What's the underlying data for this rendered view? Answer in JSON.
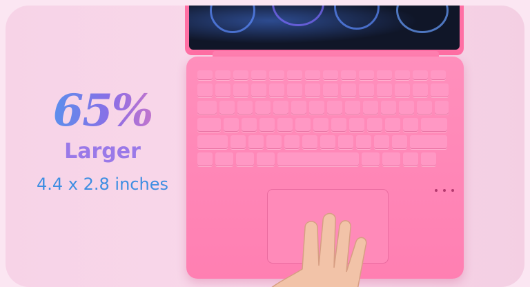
{
  "promo": {
    "percent": "65%",
    "word": "Larger",
    "dimensions": "4.4 x 2.8 inches"
  },
  "colors": {
    "background": "#f7d3e7",
    "keyboard": "#ff8fbc",
    "percent_gradient": [
      "#3ea3f0",
      "#8a6ee6",
      "#f07ab8"
    ],
    "larger_text": "#9a79e8",
    "dimensions_text": "#3e8ee2"
  },
  "image": {
    "subject": "pink-keyboard-case-icon",
    "hand": "hand-icon"
  }
}
